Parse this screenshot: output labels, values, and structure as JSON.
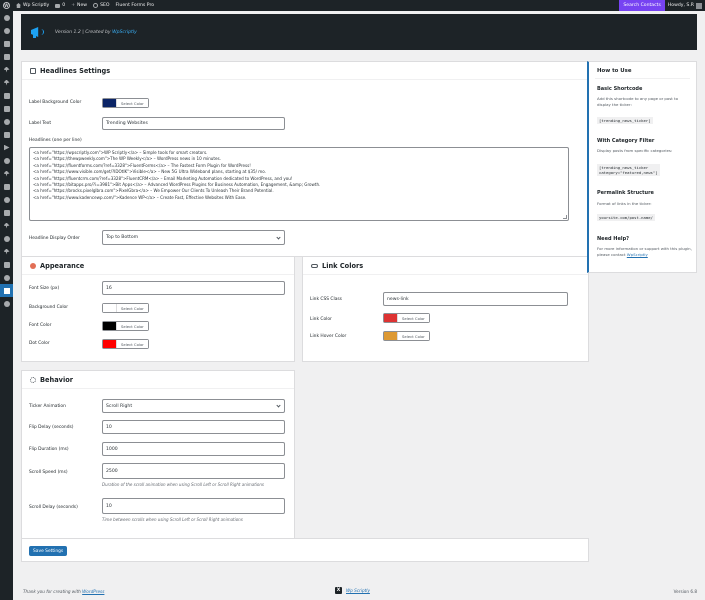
{
  "adminbar": {
    "site_name": "Wp Scriptly",
    "comments_count": "0",
    "new_label": "New",
    "seo_label": "SEO",
    "plugin_label": "Fluent Forms Pro",
    "search_label": "Search Contacts",
    "howdy": "Howdy, S.R"
  },
  "header": {
    "version_text": "Version 1.2 | Created by ",
    "author_link": "WpScriptly",
    "accent": "#1da1f2"
  },
  "headlines": {
    "title": "Headlines Settings",
    "bg_color_label": "Label Background Color",
    "bg_color_value": "#0b2466",
    "select_color": "Select Color",
    "label_text_label": "Label Text",
    "label_text_value": "Trending Websites",
    "headlines_label": "Headlines (one per line)",
    "headlines_lines": [
      "<a href=\"https://wpscriptly.com\">WP Scriptly</a> – Simple tools for smart creators.",
      "<a href=\"https://thewpweekly.com\">The WP Weekly</a> – WordPress news in 10 minutes.",
      "<a href=\"https://fluentforms.com/?ref=3328\">FluentForms</a> – The Fastest Form Plugin for WordPress!",
      "<a href=\"https://www.visible.com/get/?IDOtIK\">Visible</a> – New 5G Ultra Wideband plans, starting at $35/ mo.",
      "<a href=\"https://fluentcrm.com/?ref=3328\">FluentCRM</a> – Email Marketing Automation dedicated to WordPress, and you!",
      "<a href=\"https://bitapps.pro/?i=3981\">Bit Apps</a> – Advanced WordPress Plugins for Business Automation, Engagement, &amp; Growth.",
      "<a href=\"https://brocks.pixelglbra.com\">PixelGbra</a> – We Empower Our Clients To Unleash Their Brand Potential.",
      "<a href=\"https://www.kadencewp.com/\">Kadence WP</a> – Create Fast, Effective Websites With Ease."
    ],
    "order_label": "Headline Display Order",
    "order_value": "Top to Bottom"
  },
  "appearance": {
    "title": "Appearance",
    "font_size_label": "Font Size (px)",
    "font_size_value": "16",
    "bg_color_label": "Background Color",
    "bg_color_value": "#ffffff",
    "font_color_label": "Font Color",
    "font_color_value": "#000000",
    "dot_color_label": "Dot Color",
    "dot_color_value": "#ff0000",
    "select_color": "Select Color"
  },
  "link_colors": {
    "title": "Link Colors",
    "css_class_label": "Link CSS Class",
    "css_class_value": "news-link",
    "link_color_label": "Link Color",
    "link_color_value": "#dd3333",
    "hover_color_label": "Link Hover Color",
    "hover_color_value": "#dd9933",
    "select_color": "Select Color"
  },
  "behavior": {
    "title": "Behavior",
    "animation_label": "Ticker Animation",
    "animation_value": "Scroll Right",
    "flip_delay_label": "Flip Delay (seconds)",
    "flip_delay_value": "10",
    "flip_duration_label": "Flip Duration (ms)",
    "flip_duration_value": "1000",
    "scroll_speed_label": "Scroll Speed (ms)",
    "scroll_speed_value": "2500",
    "scroll_speed_desc": "Duration of the scroll animation when using Scroll Left or Scroll Right animations",
    "scroll_delay_label": "Scroll Delay (seconds)",
    "scroll_delay_value": "10",
    "scroll_delay_desc": "Time between scrolls when using Scroll Left or Scroll Right animations"
  },
  "save": {
    "label": "Save Settings"
  },
  "how_to": {
    "title": "How to Use",
    "basic_title": "Basic Shortcode",
    "basic_text": "Add this shortcode to any page or post to display the ticker:",
    "basic_code": "[trending_news_ticker]",
    "category_title": "With Category Filter",
    "category_text": "Display posts from specific categories:",
    "category_code": "[trending_news_ticker\ncategory=\"featured,news\"]",
    "permalink_title": "Permalink Structure",
    "permalink_text": "Format of links in the ticker:",
    "permalink_code": "yoursite.com/post-name/",
    "help_title": "Need Help?",
    "help_text": "For more information or support with this plugin, please contact ",
    "help_link": "WpScriptly"
  },
  "footer": {
    "thanks": "Thank you for creating with ",
    "wp_link": "WordPress",
    "mid_link": "Wp Scriptly",
    "version": "Version 6.8"
  }
}
